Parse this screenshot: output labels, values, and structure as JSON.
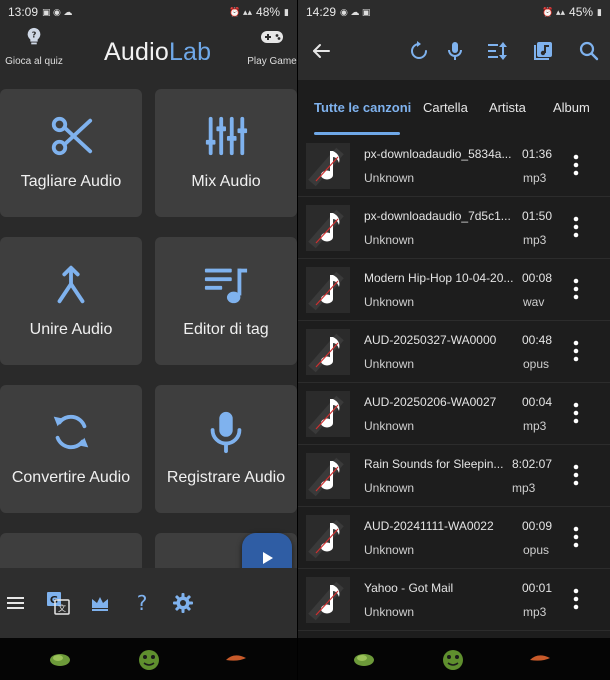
{
  "left": {
    "status": {
      "time": "13:09",
      "battery": "48%"
    },
    "header": {
      "quiz_label": "Gioca al quiz",
      "brand_audio": "Audio",
      "brand_lab": "Lab",
      "game_label": "Play Game"
    },
    "tiles": [
      {
        "label": "Tagliare Audio",
        "icon": "scissors-icon"
      },
      {
        "label": "Mix Audio",
        "icon": "equalizer-icon"
      },
      {
        "label": "Unire Audio",
        "icon": "merge-icon"
      },
      {
        "label": "Editor di tag",
        "icon": "playlist-music-icon"
      },
      {
        "label": "Convertire Audio",
        "icon": "sync-icon"
      },
      {
        "label": "Registrare Audio",
        "icon": "microphone-icon"
      }
    ],
    "toolbar": {
      "icons": [
        "menu-icon",
        "translate-icon",
        "crown-icon",
        "help-icon",
        "gear-icon"
      ]
    }
  },
  "right": {
    "status": {
      "time": "14:29",
      "battery": "45%"
    },
    "tabs": [
      {
        "label": "Tutte le canzoni",
        "active": true
      },
      {
        "label": "Cartella",
        "active": false
      },
      {
        "label": "Artista",
        "active": false
      },
      {
        "label": "Album",
        "active": false
      }
    ],
    "songs": [
      {
        "title": "px-downloadaudio_5834a...",
        "artist": "Unknown",
        "duration": "01:36",
        "format": "mp3"
      },
      {
        "title": "px-downloadaudio_7d5c1...",
        "artist": "Unknown",
        "duration": "01:50",
        "format": "mp3"
      },
      {
        "title": "Modern Hip-Hop 10-04-20...",
        "artist": "Unknown",
        "duration": "00:08",
        "format": "wav"
      },
      {
        "title": "AUD-20250327-WA0000",
        "artist": "Unknown",
        "duration": "00:48",
        "format": "opus"
      },
      {
        "title": "AUD-20250206-WA0027",
        "artist": "Unknown",
        "duration": "00:04",
        "format": "mp3"
      },
      {
        "title": "Rain Sounds for Sleepin...",
        "artist": "Unknown",
        "duration": "8:02:07",
        "format": "mp3"
      },
      {
        "title": "AUD-20241111-WA0022",
        "artist": "Unknown",
        "duration": "00:09",
        "format": "opus"
      },
      {
        "title": "Yahoo - Got Mail",
        "artist": "Unknown",
        "duration": "00:01",
        "format": "mp3"
      }
    ]
  },
  "colors": {
    "accent": "#6fa8e8",
    "fab": "#2f5da4",
    "tile": "#3e3e3e",
    "list_bg": "#1d1d1d"
  }
}
